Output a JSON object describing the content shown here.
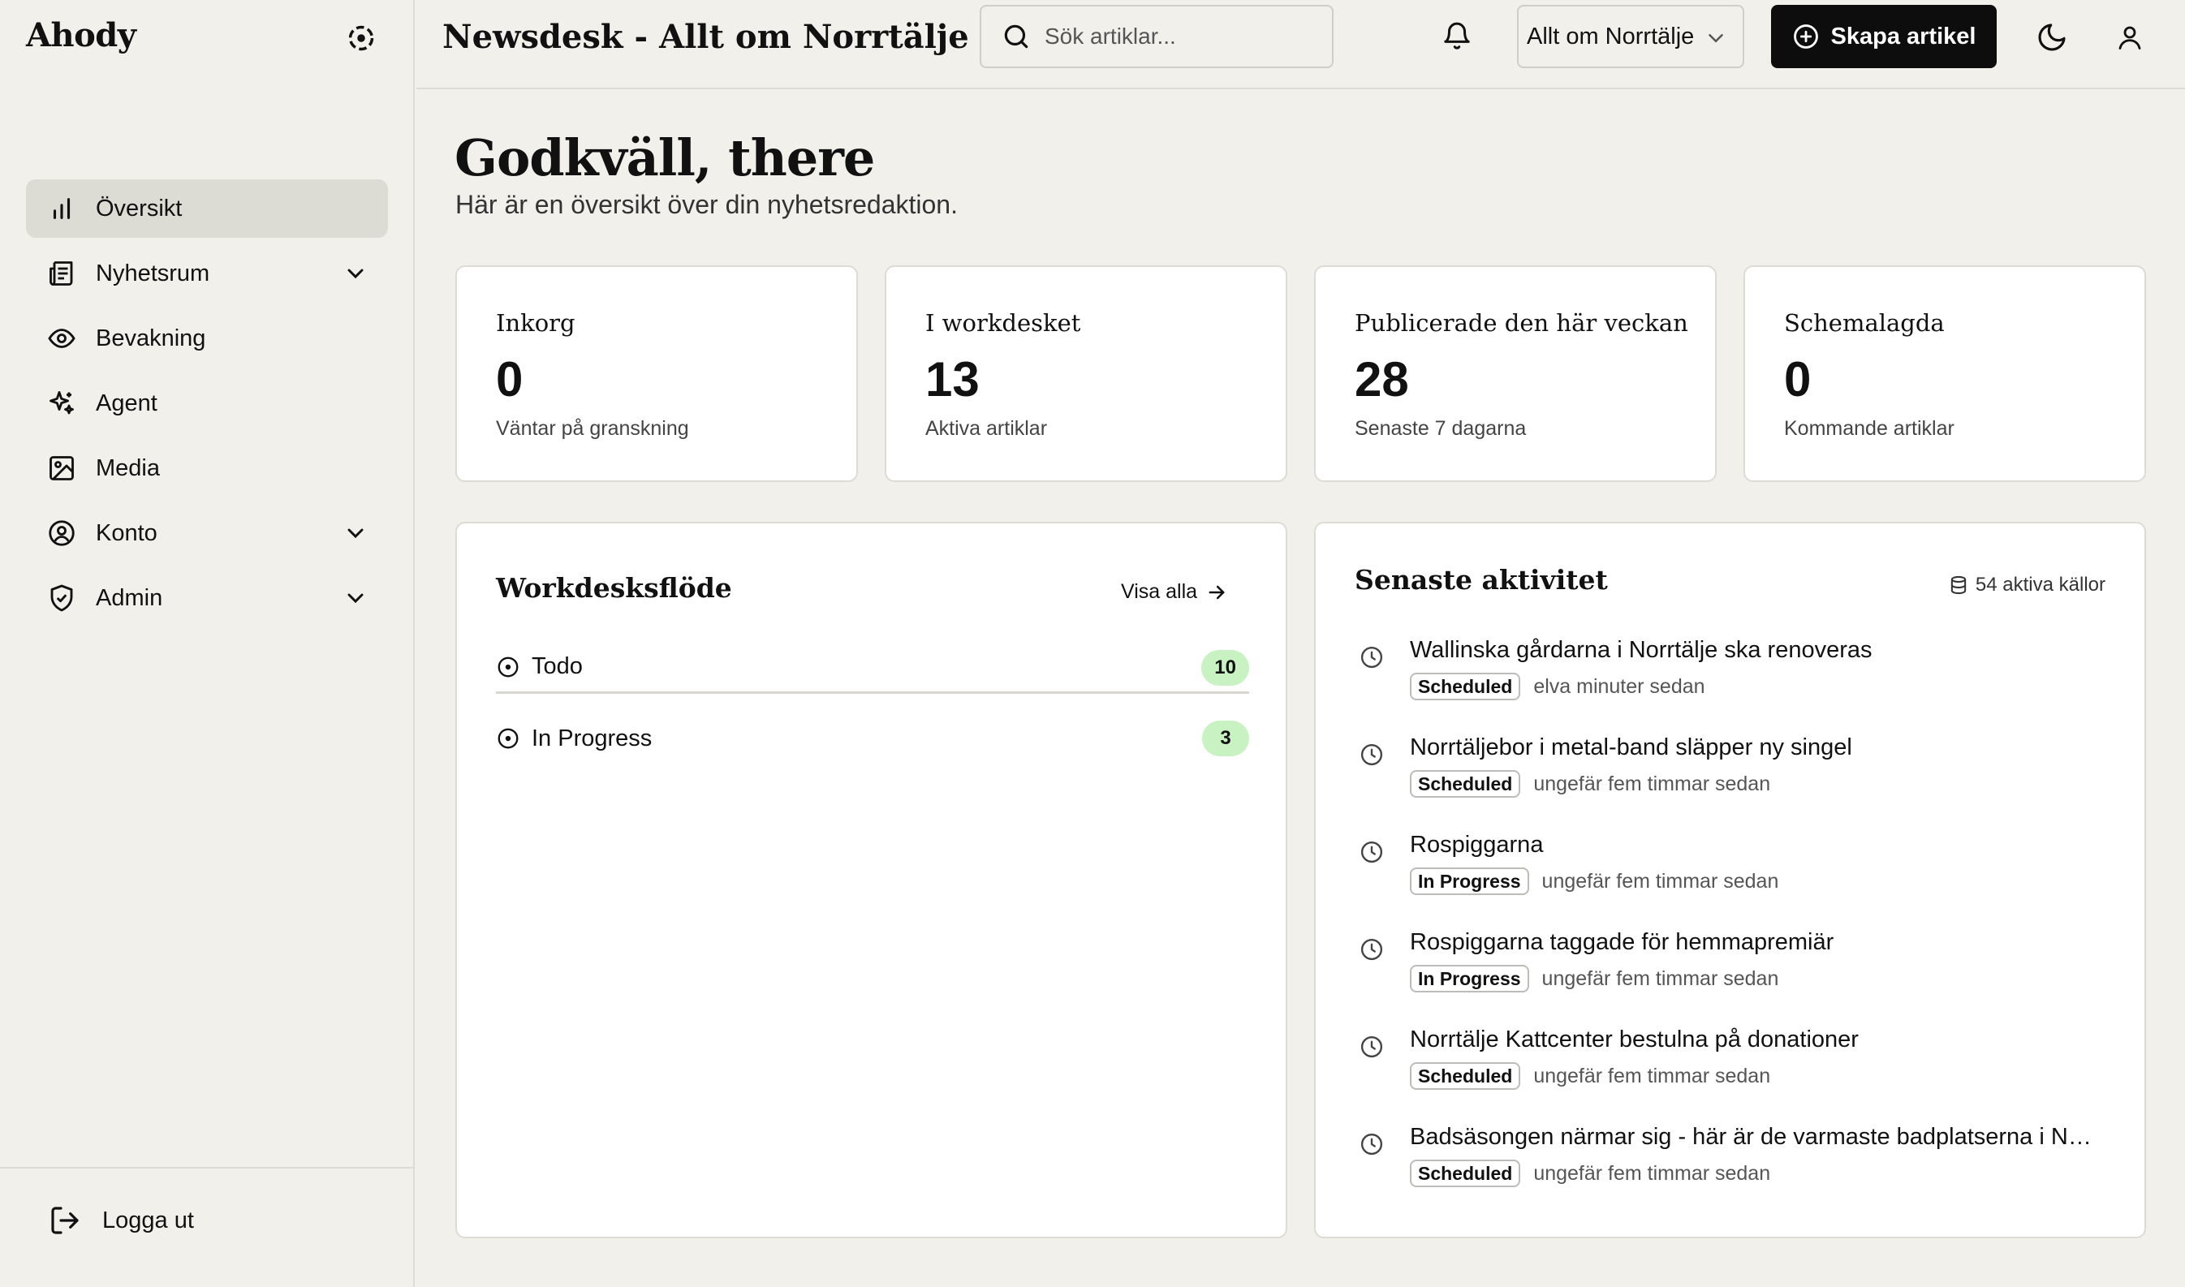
{
  "brand": "Ahody",
  "sidebar": {
    "items": [
      {
        "label": "Översikt",
        "icon": "bar-chart-icon",
        "active": true
      },
      {
        "label": "Nyhetsrum",
        "icon": "newspaper-icon",
        "expandable": true
      },
      {
        "label": "Bevakning",
        "icon": "eye-icon"
      },
      {
        "label": "Agent",
        "icon": "sparkles-icon"
      },
      {
        "label": "Media",
        "icon": "image-icon"
      },
      {
        "label": "Konto",
        "icon": "user-circle-icon",
        "expandable": true
      },
      {
        "label": "Admin",
        "icon": "shield-check-icon",
        "expandable": true
      }
    ],
    "logout_label": "Logga ut"
  },
  "header": {
    "title": "Newsdesk - Allt om Norrtälje",
    "search_placeholder": "Sök artiklar...",
    "newsroom_select": "Allt om Norrtälje",
    "create_label": "Skapa artikel"
  },
  "main": {
    "greeting": "Godkväll, there",
    "subtitle": "Här är en översikt över din nyhetsredaktion.",
    "stats": [
      {
        "title": "Inkorg",
        "value": "0",
        "desc": "Väntar på granskning"
      },
      {
        "title": "I workdesket",
        "value": "13",
        "desc": "Aktiva artiklar"
      },
      {
        "title": "Publicerade den här veckan",
        "value": "28",
        "desc": "Senaste 7 dagarna"
      },
      {
        "title": "Schemalagda",
        "value": "0",
        "desc": "Kommande artiklar"
      }
    ]
  },
  "workflow": {
    "title": "Workdesksflöde",
    "view_all": "Visa alla",
    "rows": [
      {
        "label": "Todo",
        "count": "10"
      },
      {
        "label": "In Progress",
        "count": "3"
      }
    ]
  },
  "activity": {
    "title": "Senaste aktivitet",
    "sources": "54 aktiva källor",
    "items": [
      {
        "title": "Wallinska gårdarna i Norrtälje ska renoveras",
        "status": "Scheduled",
        "time": "elva minuter sedan"
      },
      {
        "title": "Norrtäljebor i metal-band släpper ny singel",
        "status": "Scheduled",
        "time": "ungefär fem timmar sedan"
      },
      {
        "title": "Rospiggarna",
        "status": "In Progress",
        "time": "ungefär fem timmar sedan"
      },
      {
        "title": "Rospiggarna taggade för hemmapremiär",
        "status": "In Progress",
        "time": "ungefär fem timmar sedan"
      },
      {
        "title": "Norrtälje Kattcenter bestulna på donationer",
        "status": "Scheduled",
        "time": "ungefär fem timmar sedan"
      },
      {
        "title": "Badsäsongen närmar sig - här är de varmaste badplatserna i Norrtälje",
        "status": "Scheduled",
        "time": "ungefär fem timmar sedan"
      }
    ]
  },
  "colors": {
    "background": "#f1f0ea",
    "accent_dark": "#0d0d0d",
    "count_badge": "#c8f2c2",
    "active_nav": "#dcdbd4"
  }
}
